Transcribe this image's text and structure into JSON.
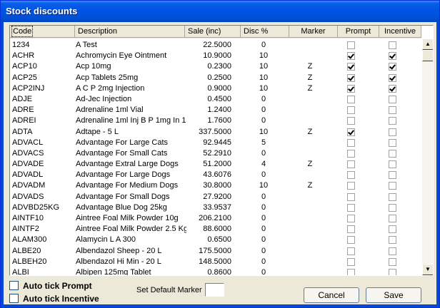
{
  "window": {
    "title": "Stock discounts"
  },
  "columns": {
    "code": "Code",
    "description": "Description",
    "sale": "Sale (inc)",
    "disc": "Disc %",
    "marker": "Marker",
    "prompt": "Prompt",
    "incentive": "Incentive"
  },
  "rows": [
    {
      "code": "1234",
      "description": "A Test",
      "sale": "22.5000",
      "disc": "0",
      "marker": "",
      "prompt": false,
      "incentive": false
    },
    {
      "code": "ACHR",
      "description": "Achromycin Eye Ointment",
      "sale": "10.9000",
      "disc": "10",
      "marker": "",
      "prompt": true,
      "incentive": true
    },
    {
      "code": "ACP10",
      "description": "Acp 10mg",
      "sale": "0.2300",
      "disc": "10",
      "marker": "Z",
      "prompt": true,
      "incentive": true
    },
    {
      "code": "ACP25",
      "description": "Acp Tablets 25mg",
      "sale": "0.2500",
      "disc": "10",
      "marker": "Z",
      "prompt": true,
      "incentive": true
    },
    {
      "code": "ACP2INJ",
      "description": "A C P 2mg Injection",
      "sale": "0.9000",
      "disc": "10",
      "marker": "Z",
      "prompt": true,
      "incentive": true
    },
    {
      "code": "ADJE",
      "description": "Ad-Jec Injection",
      "sale": "0.4500",
      "disc": "0",
      "marker": "",
      "prompt": false,
      "incentive": false
    },
    {
      "code": "ADRE",
      "description": "Adrenaline 1ml Vial",
      "sale": "1.2400",
      "disc": "0",
      "marker": "",
      "prompt": false,
      "incentive": false
    },
    {
      "code": "ADREI",
      "description": "Adrenaline 1ml Inj B P 1mg In 1",
      "sale": "1.7600",
      "disc": "0",
      "marker": "",
      "prompt": false,
      "incentive": false
    },
    {
      "code": "ADTA",
      "description": "Adtape - 5 L",
      "sale": "337.5000",
      "disc": "10",
      "marker": "Z",
      "prompt": true,
      "incentive": false
    },
    {
      "code": "ADVACL",
      "description": "Advantage For Large Cats",
      "sale": "92.9445",
      "disc": "5",
      "marker": "",
      "prompt": false,
      "incentive": false
    },
    {
      "code": "ADVACS",
      "description": "Advantage For Small Cats",
      "sale": "52.2910",
      "disc": "0",
      "marker": "",
      "prompt": false,
      "incentive": false
    },
    {
      "code": "ADVADE",
      "description": "Advantage Extral Large Dogs",
      "sale": "51.2000",
      "disc": "4",
      "marker": "Z",
      "prompt": false,
      "incentive": false
    },
    {
      "code": "ADVADL",
      "description": "Advantage For Large Dogs",
      "sale": "43.6076",
      "disc": "0",
      "marker": "",
      "prompt": false,
      "incentive": false
    },
    {
      "code": "ADVADM",
      "description": "Advantage For Medium Dogs",
      "sale": "30.8000",
      "disc": "10",
      "marker": "Z",
      "prompt": false,
      "incentive": false
    },
    {
      "code": "ADVADS",
      "description": "Advantage For Small Dogs",
      "sale": "27.9200",
      "disc": "0",
      "marker": "",
      "prompt": false,
      "incentive": false
    },
    {
      "code": "ADVBD25KG",
      "description": "Advantage Blue Dog 25kg",
      "sale": "33.9537",
      "disc": "0",
      "marker": "",
      "prompt": false,
      "incentive": false
    },
    {
      "code": "AINTF10",
      "description": "Aintree Foal Milk Powder 10g",
      "sale": "206.2100",
      "disc": "0",
      "marker": "",
      "prompt": false,
      "incentive": false
    },
    {
      "code": "AINTF2",
      "description": "Aintree Foal Milk Powder 2.5 Kg",
      "sale": "88.6000",
      "disc": "0",
      "marker": "",
      "prompt": false,
      "incentive": false
    },
    {
      "code": "ALAM300",
      "description": "Alamycin L A 300",
      "sale": "0.6500",
      "disc": "0",
      "marker": "",
      "prompt": false,
      "incentive": false
    },
    {
      "code": "ALBE20",
      "description": "Albendazol Sheep - 20 L",
      "sale": "175.5000",
      "disc": "0",
      "marker": "",
      "prompt": false,
      "incentive": false
    },
    {
      "code": "ALBEH20",
      "description": "Albendazol Hi Min - 20 L",
      "sale": "148.5000",
      "disc": "0",
      "marker": "",
      "prompt": false,
      "incentive": false
    },
    {
      "code": "ALBI",
      "description": "Albipen 125mg Tablet",
      "sale": "0.8600",
      "disc": "0",
      "marker": "",
      "prompt": false,
      "incentive": false
    }
  ],
  "scroll_arrows": {
    "up": "▲",
    "down": "▼"
  },
  "options": {
    "auto_prompt": "Auto tick Prompt",
    "auto_incentive": "Auto tick Incentive",
    "default_marker_label": "Set Default Marker",
    "default_marker_value": ""
  },
  "buttons": {
    "cancel": "Cancel",
    "save": "Save"
  }
}
